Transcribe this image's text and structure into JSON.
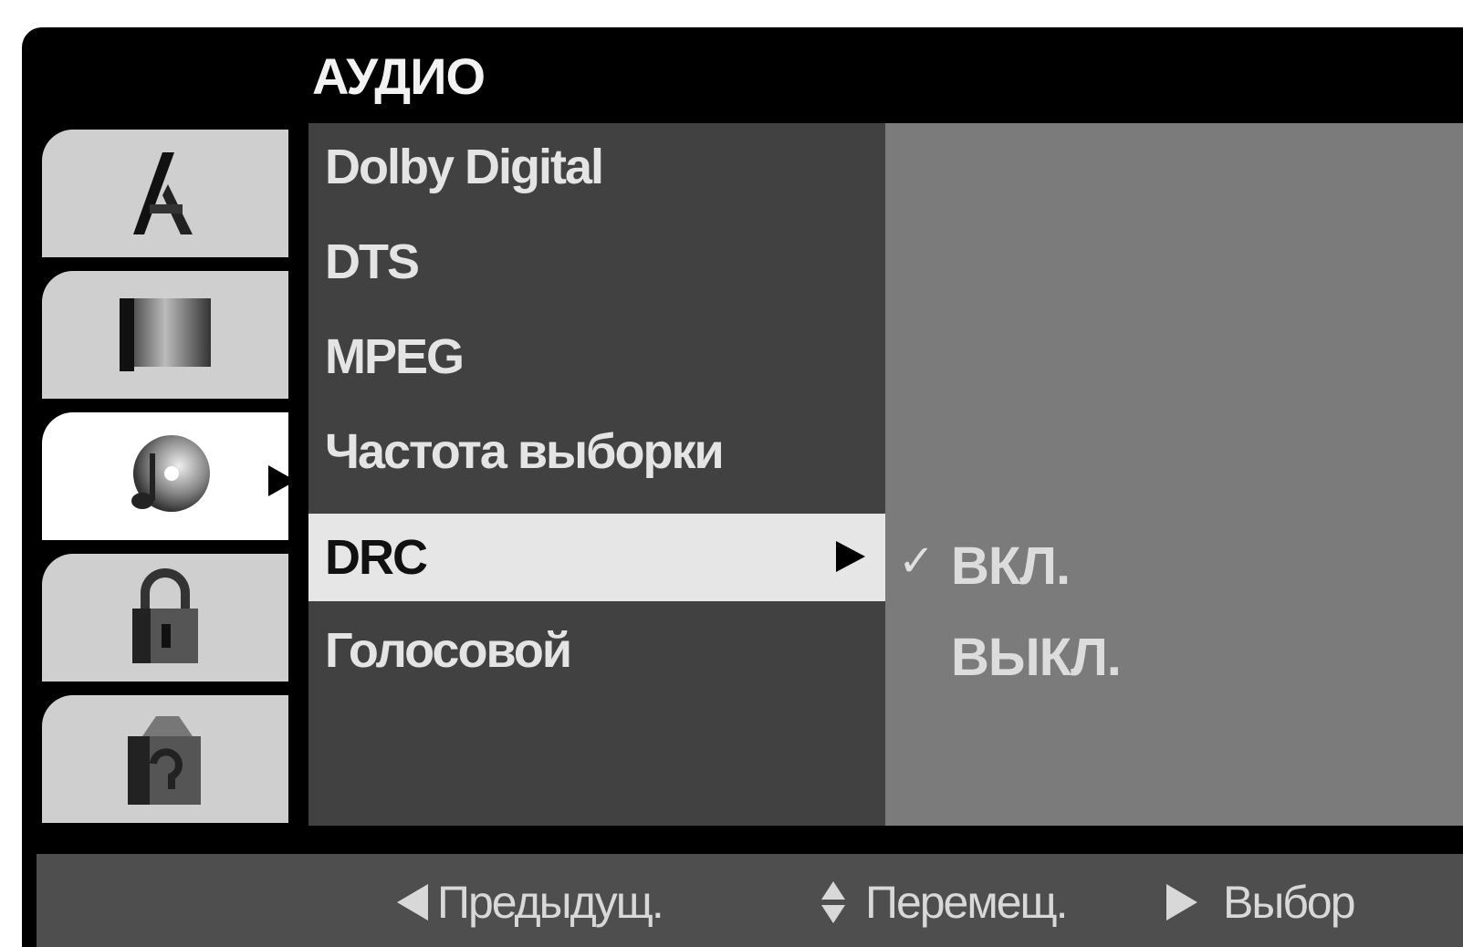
{
  "menu_title": "АУДИО",
  "tabs": [
    {
      "icon": "language-icon",
      "active": false
    },
    {
      "icon": "display-icon",
      "active": false
    },
    {
      "icon": "audio-disc-icon",
      "active": true
    },
    {
      "icon": "lock-icon",
      "active": false
    },
    {
      "icon": "others-icon",
      "active": false
    }
  ],
  "menu_items": [
    {
      "label": "Dolby Digital"
    },
    {
      "label": "DTS"
    },
    {
      "label": "MPEG"
    },
    {
      "label": "Частота выборки"
    },
    {
      "label": "DRC",
      "selected": true
    },
    {
      "label": "Голосовой"
    }
  ],
  "options": [
    {
      "label": "ВКЛ.",
      "checked": true,
      "check_mark": "✓"
    },
    {
      "label": "ВЫКЛ.",
      "checked": false
    }
  ],
  "hints": {
    "back": "Предыдущ.",
    "move": "Перемещ.",
    "select": "Выбор"
  },
  "colors": {
    "background": "#000000",
    "menu_bg": "#414141",
    "options_bg": "#7b7b7b",
    "selected_bg": "#e6e6e6",
    "tab_bg": "#cfcfcf",
    "tab_active_bg": "#ffffff"
  }
}
